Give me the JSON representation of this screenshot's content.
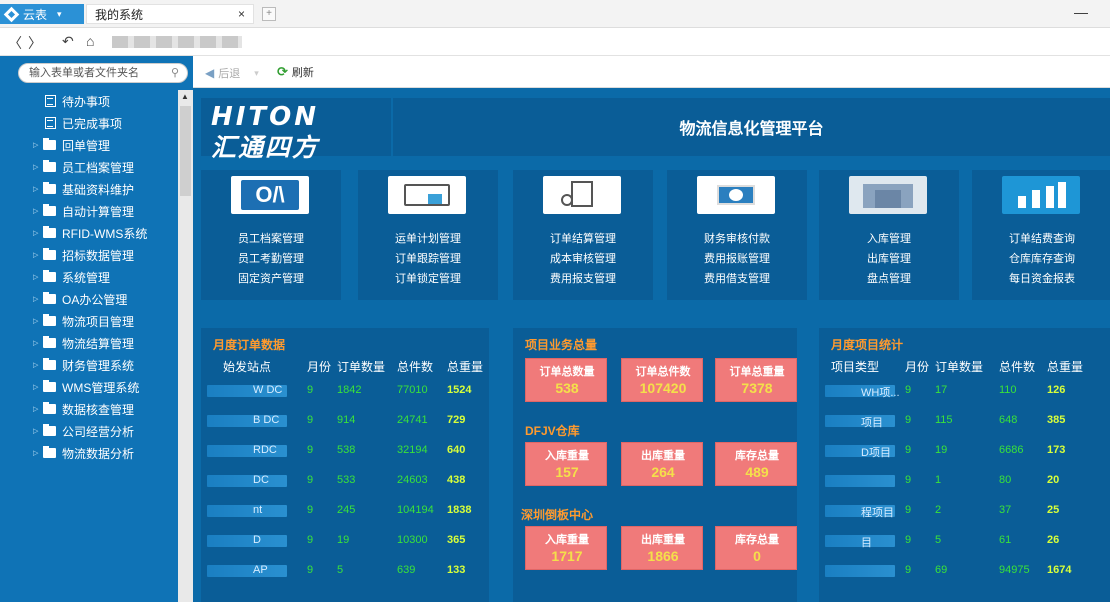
{
  "browser": {
    "app_label": "云表",
    "tab_title": "我的系统",
    "tab_close": "×",
    "new_tab": "+",
    "minimize": "—"
  },
  "nav": {
    "back": "〈",
    "forward": "〉",
    "undo": "↶",
    "home": "⌂"
  },
  "sidebar": {
    "search_placeholder": "输入表单或者文件夹名",
    "items": [
      {
        "label": "待办事项",
        "kind": "doc"
      },
      {
        "label": "已完成事项",
        "kind": "doc"
      },
      {
        "label": "回单管理",
        "kind": "folder"
      },
      {
        "label": "员工档案管理",
        "kind": "folder"
      },
      {
        "label": "基础资料维护",
        "kind": "folder"
      },
      {
        "label": "自动计算管理",
        "kind": "folder"
      },
      {
        "label": "RFID-WMS系统",
        "kind": "folder"
      },
      {
        "label": "招标数据管理",
        "kind": "folder"
      },
      {
        "label": "系统管理",
        "kind": "folder"
      },
      {
        "label": "OA办公管理",
        "kind": "folder"
      },
      {
        "label": "物流项目管理",
        "kind": "folder"
      },
      {
        "label": "物流结算管理",
        "kind": "folder"
      },
      {
        "label": "财务管理系统",
        "kind": "folder"
      },
      {
        "label": "WMS管理系统",
        "kind": "folder"
      },
      {
        "label": "数据核查管理",
        "kind": "folder"
      },
      {
        "label": "公司经营分析",
        "kind": "folder"
      },
      {
        "label": "物流数据分析",
        "kind": "folder"
      }
    ]
  },
  "toolbar": {
    "back_label": "后退",
    "refresh_label": "刷新"
  },
  "header": {
    "brand_en": "HITON",
    "brand_cn": "汇通四方",
    "platform_title": "物流信息化管理平台"
  },
  "modules": [
    {
      "icon": "oa-icon",
      "links": [
        "员工档案管理",
        "员工考勤管理",
        "固定资产管理"
      ]
    },
    {
      "icon": "waybill-icon",
      "links": [
        "运单计划管理",
        "订单跟踪管理",
        "订单锁定管理"
      ]
    },
    {
      "icon": "settlement-icon",
      "links": [
        "订单结算管理",
        "成本审核管理",
        "费用报支管理"
      ]
    },
    {
      "icon": "payment-icon",
      "links": [
        "财务审核付款",
        "费用报账管理",
        "费用借支管理"
      ]
    },
    {
      "icon": "warehouse-icon",
      "links": [
        "入库管理",
        "出库管理",
        "盘点管理"
      ]
    },
    {
      "icon": "chart-icon",
      "links": [
        "订单结费查询",
        "仓库库存查询",
        "每日资金报表"
      ]
    }
  ],
  "monthly_orders": {
    "title": "月度订单数据",
    "headers": [
      "始发站点",
      "月份",
      "订单数量",
      "总件数",
      "总重量"
    ],
    "rows": [
      {
        "site": "W DC",
        "month": "9",
        "orders": "1842",
        "pieces": "77010",
        "weight": "1524"
      },
      {
        "site": "B DC",
        "month": "9",
        "orders": "914",
        "pieces": "24741",
        "weight": "729"
      },
      {
        "site": "RDC",
        "month": "9",
        "orders": "538",
        "pieces": "32194",
        "weight": "640"
      },
      {
        "site": "DC",
        "month": "9",
        "orders": "533",
        "pieces": "24603",
        "weight": "438"
      },
      {
        "site": "nt",
        "month": "9",
        "orders": "245",
        "pieces": "104194",
        "weight": "1838"
      },
      {
        "site": "D",
        "month": "9",
        "orders": "19",
        "pieces": "10300",
        "weight": "365"
      },
      {
        "site": "AP",
        "month": "9",
        "orders": "5",
        "pieces": "639",
        "weight": "133"
      }
    ]
  },
  "project_summary": {
    "title": "项目业务总量",
    "kpis": [
      {
        "label": "订单总数量",
        "value": "538"
      },
      {
        "label": "订单总件数",
        "value": "107420"
      },
      {
        "label": "订单总重量",
        "value": "7378"
      }
    ],
    "dfjv_title": "DFJV仓库",
    "dfjv": [
      {
        "label": "入库重量",
        "value": "157"
      },
      {
        "label": "出库重量",
        "value": "264"
      },
      {
        "label": "库存总量",
        "value": "489"
      }
    ],
    "sz_title": "深圳倒板中心",
    "sz": [
      {
        "label": "入库重量",
        "value": "1717"
      },
      {
        "label": "出库重量",
        "value": "1866"
      },
      {
        "label": "库存总量",
        "value": "0"
      }
    ]
  },
  "monthly_projects": {
    "title": "月度项目统计",
    "headers": [
      "项目类型",
      "月份",
      "订单数量",
      "总件数",
      "总重量"
    ],
    "rows": [
      {
        "type": "WH项...",
        "month": "9",
        "orders": "17",
        "pieces": "110",
        "weight": "126"
      },
      {
        "type": "项目",
        "month": "9",
        "orders": "115",
        "pieces": "648",
        "weight": "385"
      },
      {
        "type": "D项目",
        "month": "9",
        "orders": "19",
        "pieces": "6686",
        "weight": "173"
      },
      {
        "type": "",
        "month": "9",
        "orders": "1",
        "pieces": "80",
        "weight": "20"
      },
      {
        "type": "程项目",
        "month": "9",
        "orders": "2",
        "pieces": "37",
        "weight": "25"
      },
      {
        "type": "目",
        "month": "9",
        "orders": "5",
        "pieces": "61",
        "weight": "26"
      },
      {
        "type": "",
        "month": "9",
        "orders": "69",
        "pieces": "94975",
        "weight": "1674"
      }
    ]
  },
  "colors": {
    "sidebar": "#0f73b6",
    "main_bg": "#0b6aa8",
    "panel_bg": "#0a5d97",
    "accent_orange": "#ff9a2e",
    "value_green": "#39e23a",
    "kpi_red": "#f07a7a"
  }
}
